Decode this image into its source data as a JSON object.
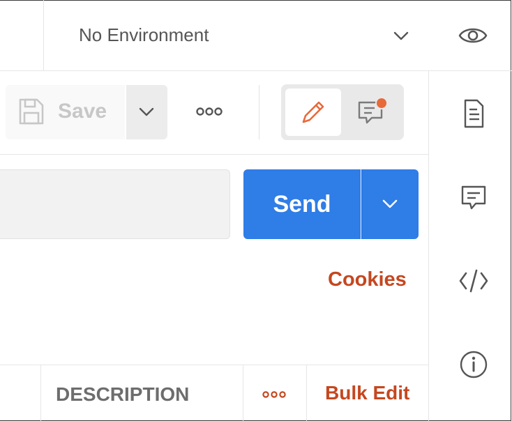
{
  "environment": {
    "selected": "No Environment"
  },
  "toolbar": {
    "save_label": "Save"
  },
  "request": {
    "url_value": "",
    "send_label": "Send",
    "cookies_label": "Cookies"
  },
  "params_table": {
    "headers": [
      "DESCRIPTION"
    ],
    "bulk_edit_label": "Bulk Edit"
  },
  "colors": {
    "accent": "#2f7de6",
    "link": "#c5471f",
    "notification": "#e8693a"
  }
}
